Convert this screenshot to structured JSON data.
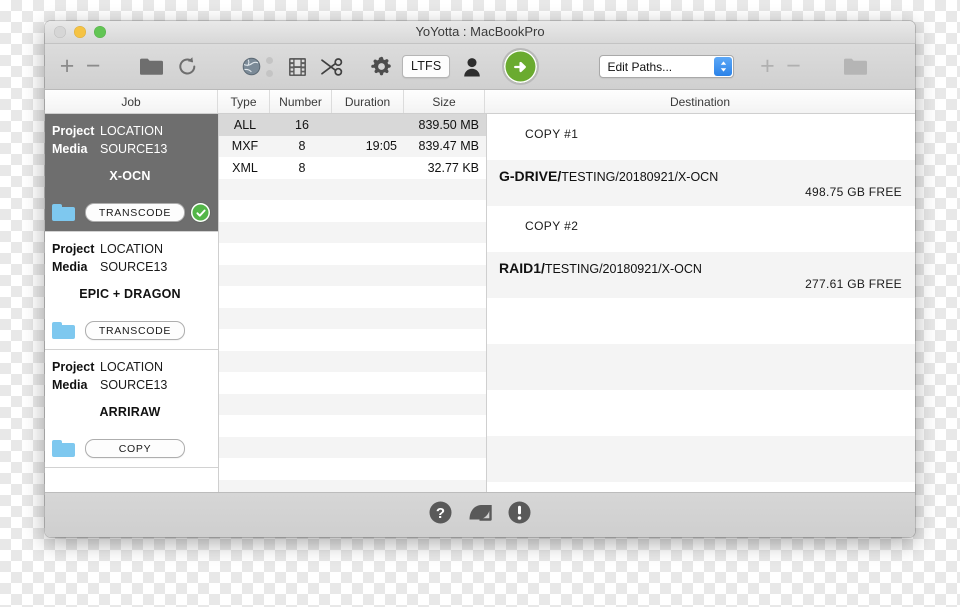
{
  "window": {
    "title": "YoYotta : MacBookPro",
    "traffic_lights": [
      "close",
      "minimize",
      "maximize"
    ]
  },
  "toolbar": {
    "add_label": "+",
    "remove_label": "−",
    "folder_icon": "folder-icon",
    "refresh_icon": "refresh-icon",
    "globe_icon": "globe-icon",
    "film_icon": "film-strip-icon",
    "scissors_icon": "scissors-icon",
    "gear_icon": "gear-icon",
    "ltfs_label": "LTFS",
    "person_icon": "person-icon",
    "go_icon": "green-arrow-go-icon",
    "paths_select_value": "Edit Paths...",
    "dest_add_label": "+",
    "dest_remove_label": "−",
    "dest_folder_icon": "folder-icon",
    "accent_green": "#6aab2f",
    "accent_blue": "#2a82e8"
  },
  "columns": {
    "job": "Job",
    "type": "Type",
    "number": "Number",
    "duration": "Duration",
    "size": "Size",
    "destination": "Destination"
  },
  "jobs": [
    {
      "project_key": "Project",
      "project_value": "LOCATION",
      "media_key": "Media",
      "media_value": "SOURCE13",
      "name": "X-OCN",
      "action": "TRANSCODE",
      "selected": true,
      "status": "complete"
    },
    {
      "project_key": "Project",
      "project_value": "LOCATION",
      "media_key": "Media",
      "media_value": "SOURCE13",
      "name": "EPIC + DRAGON",
      "action": "TRANSCODE",
      "selected": false,
      "status": ""
    },
    {
      "project_key": "Project",
      "project_value": "LOCATION",
      "media_key": "Media",
      "media_value": "SOURCE13",
      "name": "ARRIRAW",
      "action": "COPY",
      "selected": false,
      "status": ""
    }
  ],
  "files": {
    "rows": [
      {
        "type": "ALL",
        "number": "16",
        "duration": "",
        "size": "839.50 MB",
        "selected": true
      },
      {
        "type": "MXF",
        "number": "8",
        "duration": "19:05",
        "size": "839.47 MB",
        "selected": false
      },
      {
        "type": "XML",
        "number": "8",
        "duration": "",
        "size": "32.77 KB",
        "selected": false
      }
    ]
  },
  "destinations": [
    {
      "copy_label": "COPY #1",
      "volume": "G-DRIVE/",
      "path": "TESTING/20180921/X-OCN",
      "free": "498.75 GB FREE"
    },
    {
      "copy_label": "COPY #2",
      "volume": "RAID1/",
      "path": "TESTING/20180921/X-OCN",
      "free": "277.61 GB FREE"
    }
  ],
  "statusbar": {
    "help_icon": "question-mark-icon",
    "manual_icon": "book-icon",
    "alert_icon": "exclamation-mark-icon"
  }
}
